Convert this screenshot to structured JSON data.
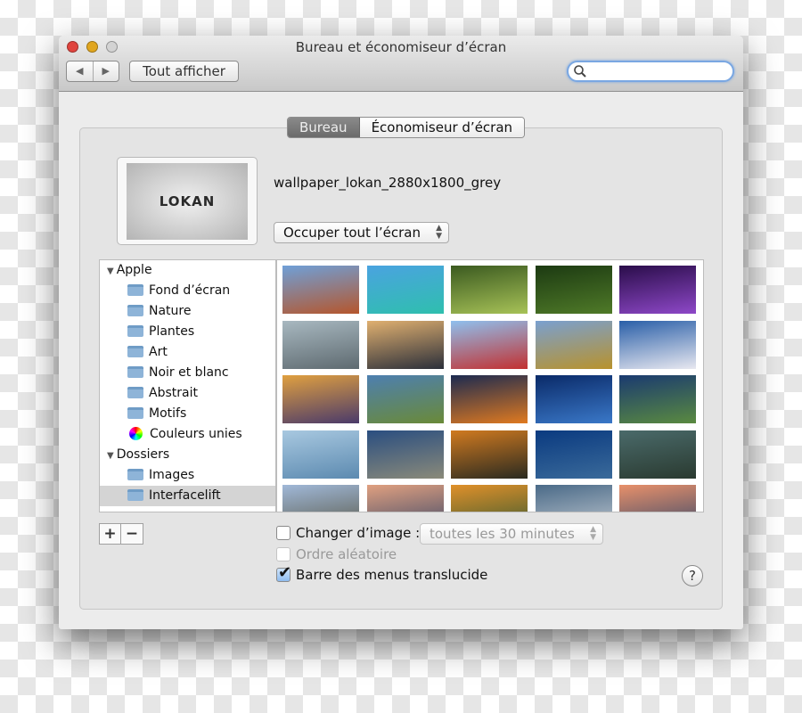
{
  "window": {
    "title": "Bureau et économiseur d’écran",
    "show_all": "Tout afficher",
    "search_placeholder": "",
    "back_icon": "◀",
    "forward_icon": "▶"
  },
  "tabs": [
    {
      "label": "Bureau",
      "selected": true
    },
    {
      "label": "Économiseur d’écran",
      "selected": false
    }
  ],
  "preview": {
    "logo_text": "LOKAN",
    "filename": "wallpaper_lokan_2880x1800_grey",
    "fit_option": "Occuper tout l’écran"
  },
  "sidebar": [
    {
      "label": "Apple",
      "type": "group"
    },
    {
      "label": "Fond d’écran",
      "type": "folder"
    },
    {
      "label": "Nature",
      "type": "folder"
    },
    {
      "label": "Plantes",
      "type": "folder"
    },
    {
      "label": "Art",
      "type": "folder"
    },
    {
      "label": "Noir et blanc",
      "type": "folder"
    },
    {
      "label": "Abstrait",
      "type": "folder"
    },
    {
      "label": "Motifs",
      "type": "folder"
    },
    {
      "label": "Couleurs unies",
      "type": "colors"
    },
    {
      "label": "Dossiers",
      "type": "group"
    },
    {
      "label": "Images",
      "type": "folder"
    },
    {
      "label": "Interfacelift",
      "type": "folder",
      "selected": true
    }
  ],
  "thumbnails": [
    [
      "#6fa0d8",
      "#b5562c"
    ],
    [
      "#4aa3e0",
      "#2fbfae"
    ],
    [
      "#3b5a20",
      "#a7c257"
    ],
    [
      "#1c3a12",
      "#4f7a28"
    ],
    [
      "#2a0d4a",
      "#8e48c8"
    ],
    [
      "#a8b8c0",
      "#5e6a70"
    ],
    [
      "#e0b070",
      "#2b2f3a"
    ],
    [
      "#8fc0ee",
      "#c23030"
    ],
    [
      "#7aa0d0",
      "#b8922c"
    ],
    [
      "#2a5fa8",
      "#e8e8f0"
    ],
    [
      "#e0a040",
      "#4a3a6a"
    ],
    [
      "#4d7fb0",
      "#6a8a38"
    ],
    [
      "#1c2a50",
      "#e07a20"
    ],
    [
      "#0a2a68",
      "#3a78c8"
    ],
    [
      "#1a3a70",
      "#5a8a40"
    ],
    [
      "#a8c8e0",
      "#5c8ab0"
    ],
    [
      "#2a4e80",
      "#8a8a7a"
    ],
    [
      "#d07a20",
      "#2a2a20"
    ],
    [
      "#0a3a80",
      "#3a6a9a"
    ],
    [
      "#4a6a6a",
      "#2a3a30"
    ],
    [
      "#a0b8d8",
      "#5a5a4a"
    ],
    [
      "#e0a080",
      "#404a68"
    ],
    [
      "#e0902a",
      "#3a5a30"
    ],
    [
      "#4a6a88",
      "#c0c8d0"
    ],
    [
      "#e8906a",
      "#3a4a6a"
    ]
  ],
  "controls": {
    "add": "+",
    "remove": "−",
    "change_image_label": "Changer d’image :",
    "change_image_checked": false,
    "interval": "toutes les 30 minutes",
    "random_label": "Ordre aléatoire",
    "random_checked": false,
    "random_enabled": false,
    "translucent_label": "Barre des menus translucide",
    "translucent_checked": true,
    "help": "?"
  },
  "colors": {
    "close": "#e0443e",
    "minimize": "#e1a61f",
    "zoom": "#cfcfcf",
    "focus_ring": "#7aa7e2"
  }
}
